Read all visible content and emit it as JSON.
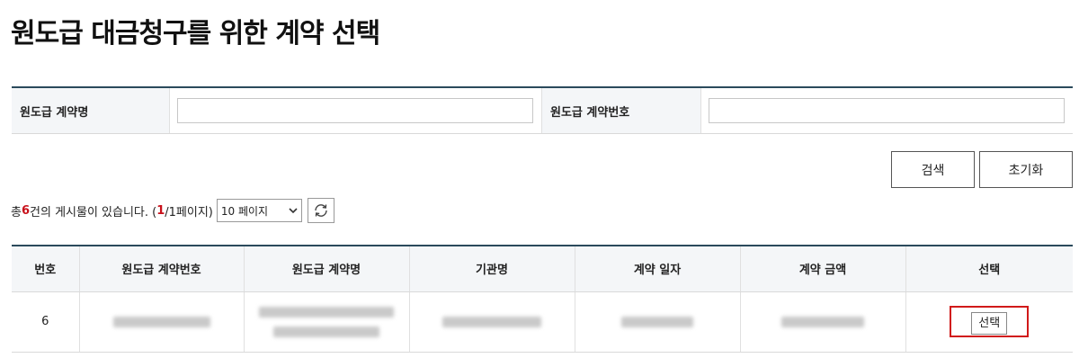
{
  "page": {
    "title": "원도급 대금청구를 위한 계약 선택"
  },
  "search": {
    "contract_name_label": "원도급 계약명",
    "contract_name_value": "",
    "contract_no_label": "원도급 계약번호",
    "contract_no_value": ""
  },
  "buttons": {
    "search_label": "검색",
    "reset_label": "초기화"
  },
  "summary": {
    "prefix": "총 ",
    "count": "6",
    "mid": "건의 게시물이 있습니다. (",
    "current_page": "1",
    "rest": " /1페이지)",
    "page_size_selected": "10 페이지"
  },
  "table": {
    "headers": [
      "번호",
      "원도급 계약번호",
      "원도급 계약명",
      "기관명",
      "계약 일자",
      "계약 금액",
      "선택"
    ],
    "rows": [
      {
        "no": "6",
        "select_label": "선택"
      }
    ]
  },
  "colors": {
    "header_border": "#2b4a5c",
    "highlight": "#d11a1a",
    "count_red": "#c8101a"
  }
}
